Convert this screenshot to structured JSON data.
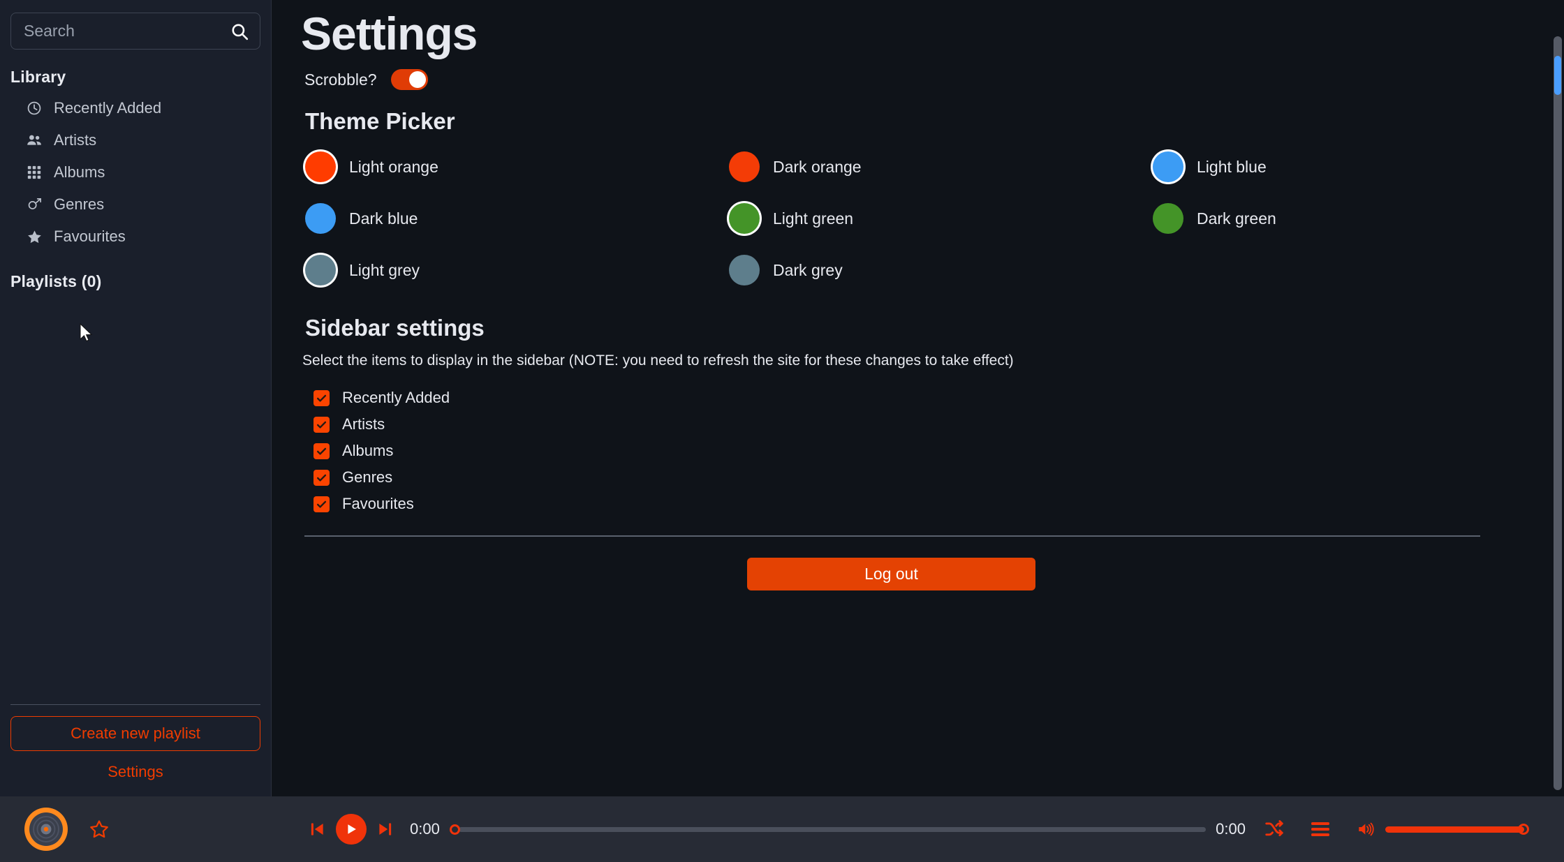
{
  "sidebar": {
    "search": {
      "placeholder": "Search",
      "value": "",
      "icon": "search-icon"
    },
    "library_title": "Library",
    "items": [
      {
        "label": "Recently Added",
        "icon": "clock-icon"
      },
      {
        "label": "Artists",
        "icon": "users-icon"
      },
      {
        "label": "Albums",
        "icon": "grid-icon"
      },
      {
        "label": "Genres",
        "icon": "venus-mars-icon"
      },
      {
        "label": "Favourites",
        "icon": "star-icon"
      }
    ],
    "playlists_title": "Playlists (0)",
    "create_playlist_label": "Create new playlist",
    "settings_label": "Settings"
  },
  "main": {
    "title": "Settings",
    "scrobble": {
      "label": "Scrobble?",
      "enabled": true
    },
    "theme_picker": {
      "heading": "Theme Picker",
      "options": [
        {
          "label": "Light orange",
          "color": "#ff3c00",
          "selected": true
        },
        {
          "label": "Dark orange",
          "color": "#f43c06",
          "selected": false
        },
        {
          "label": "Light blue",
          "color": "#3c9cf4",
          "selected": true
        },
        {
          "label": "Dark blue",
          "color": "#3c9cf4",
          "selected": false
        },
        {
          "label": "Light green",
          "color": "#449428",
          "selected": true
        },
        {
          "label": "Dark green",
          "color": "#449428",
          "selected": false
        },
        {
          "label": "Light grey",
          "color": "#5e7e8c",
          "selected": true
        },
        {
          "label": "Dark grey",
          "color": "#5e7e8c",
          "selected": false
        }
      ]
    },
    "sidebar_settings": {
      "heading": "Sidebar settings",
      "note": "Select the items to display in the sidebar (NOTE: you need to refresh the site for these changes to take effect)",
      "checkboxes": [
        {
          "label": "Recently Added",
          "checked": true
        },
        {
          "label": "Artists",
          "checked": true
        },
        {
          "label": "Albums",
          "checked": true
        },
        {
          "label": "Genres",
          "checked": true
        },
        {
          "label": "Favourites",
          "checked": true
        }
      ]
    },
    "logout_label": "Log out"
  },
  "player": {
    "favourite_icon": "star-outline-icon",
    "album_art_icon": "vinyl-record-icon",
    "previous_icon": "skip-previous-icon",
    "play_icon": "play-icon",
    "next_icon": "skip-next-icon",
    "time_current": "0:00",
    "time_total": "0:00",
    "shuffle_icon": "shuffle-icon",
    "queue_icon": "queue-list-icon",
    "volume_icon": "volume-up-icon",
    "seek_percent": 0,
    "volume_percent": 100
  },
  "colors": {
    "accent": "#f03c00",
    "background": "#0f1319",
    "sidebar_background": "#1a1f2b",
    "player_background": "#272b35",
    "scrollbar_thumb": "#4a9eff"
  }
}
